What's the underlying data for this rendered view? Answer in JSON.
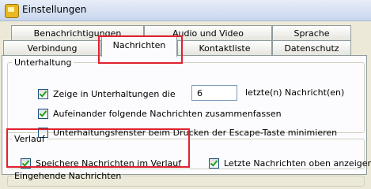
{
  "window": {
    "title": "Einstellungen"
  },
  "tabs_back": [
    "Benachrichtigungen",
    "Audio und Video",
    "Sprache"
  ],
  "tabs_front": [
    "Verbindung",
    "Nachrichten",
    "Kontaktliste",
    "Datenschutz"
  ],
  "unterhaltung": {
    "legend": "Unterhaltung",
    "show_last_label": "Zeige in Unterhaltungen die",
    "show_last_value": "6",
    "show_last_suffix": "letzte(n) Nachricht(en)",
    "merge_label": "Aufeinander folgende Nachrichten zusammenfassen",
    "minimize_label": "Unterhaltungsfenster beim Drücken der Escape-Taste minimieren"
  },
  "verlauf": {
    "legend": "Verlauf",
    "save_label": "Speichere Nachrichten im Verlauf",
    "newest_top_label": "Letzte Nachrichten oben anzeigen"
  },
  "next_group_legend": "Eingehende Nachrichten"
}
